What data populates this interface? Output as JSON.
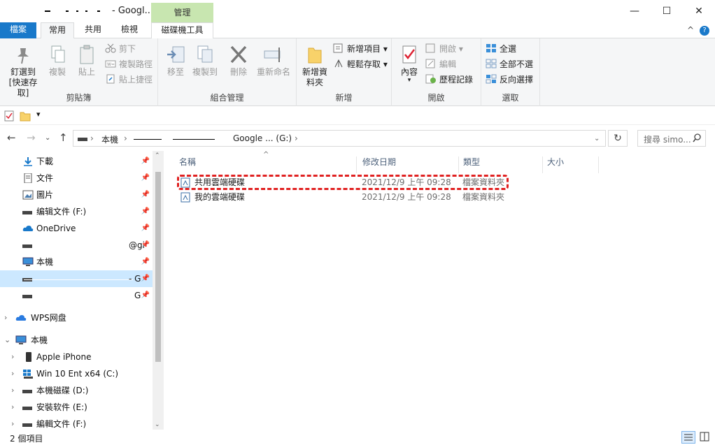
{
  "window": {
    "title_suffix": "- Googl...",
    "context_tab_header": "管理",
    "minimize": "—",
    "maximize": "☐",
    "close": "✕"
  },
  "ribbon_tabs": [
    {
      "label": "檔案"
    },
    {
      "label": "常用"
    },
    {
      "label": "共用"
    },
    {
      "label": "檢視"
    },
    {
      "label": "磁碟機工具"
    }
  ],
  "ribbon_help": "?",
  "ribbon_collapse": "^",
  "ribbon": {
    "clipboard": {
      "label": "剪貼簿",
      "pin_quick": "釘選到 [快速存取]",
      "copy": "複製",
      "paste": "貼上",
      "cut": "剪下",
      "copy_path": "複製路徑",
      "paste_shortcut": "貼上捷徑"
    },
    "organize": {
      "label": "組合管理",
      "move_to": "移至",
      "copy_to": "複製到",
      "delete": "刪除",
      "rename": "重新命名"
    },
    "new": {
      "label": "新增",
      "new_folder": "新增資料夾",
      "new_item": "新增項目",
      "easy_access": "輕鬆存取"
    },
    "open": {
      "label": "開啟",
      "properties": "內容",
      "open": "開啟",
      "edit": "編輯",
      "history": "歷程記錄"
    },
    "select": {
      "label": "選取",
      "select_all": "全選",
      "select_none": "全部不選",
      "invert": "反向選擇"
    }
  },
  "address": {
    "root": "本機",
    "drive": "Google ... (G:)",
    "search_placeholder": "搜尋 simo..."
  },
  "nav_pane": {
    "quick_items": [
      {
        "label": "下載"
      },
      {
        "label": "文件"
      },
      {
        "label": "圖片"
      },
      {
        "label": "编辑文件 (F:)"
      },
      {
        "label": "OneDrive"
      },
      {
        "label": "@gi"
      },
      {
        "label": "本機"
      },
      {
        "label": "- G"
      },
      {
        "label": "G"
      }
    ],
    "wps": "WPS网盘",
    "this_pc": "本機",
    "pc_items": [
      {
        "label": "Apple iPhone"
      },
      {
        "label": "Win 10 Ent x64 (C:)"
      },
      {
        "label": "本機磁碟 (D:)"
      },
      {
        "label": "安裝软件 (E:)"
      },
      {
        "label": "編輯文件 (F:)"
      }
    ]
  },
  "columns": {
    "name": "名稱",
    "modified": "修改日期",
    "type": "類型",
    "size": "大小"
  },
  "files": [
    {
      "name": "共用雲端硬碟",
      "modified": "2021/12/9 上午 09:28",
      "type": "檔案資料夾"
    },
    {
      "name": "我的雲端硬碟",
      "modified": "2021/12/9 上午 09:28",
      "type": "檔案資料夾"
    }
  ],
  "status": {
    "count": "2 個項目"
  },
  "colors": {
    "file_tab": "#1979ca",
    "context_tab": "#c8e6b0",
    "selection": "#cce8ff",
    "highlight": "#e02020"
  }
}
